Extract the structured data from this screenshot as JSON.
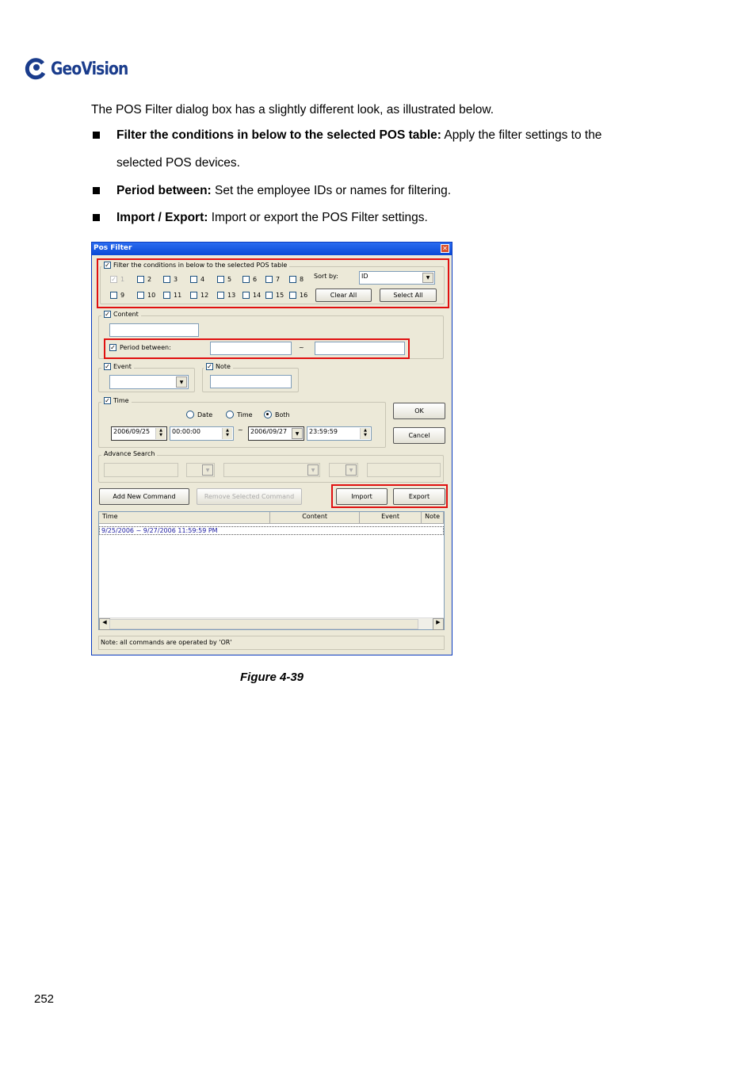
{
  "logo": {
    "text": "GeoVision"
  },
  "intro": "The POS Filter dialog box has a slightly different look, as illustrated below.",
  "bullets": [
    {
      "bold": "Filter the conditions in below to the selected POS table:",
      "text": " Apply the filter settings to the",
      "cont": "selected POS devices."
    },
    {
      "bold": "Period between:",
      "text": " Set the employee IDs or names for filtering."
    },
    {
      "bold": "Import / Export:",
      "text": " Import or export the POS Filter settings."
    }
  ],
  "dialog": {
    "title": "Pos Filter",
    "filter_label": "Filter the conditions in below to the selected POS table",
    "pos_numbers": [
      "1",
      "2",
      "3",
      "4",
      "5",
      "6",
      "7",
      "8",
      "9",
      "10",
      "11",
      "12",
      "13",
      "14",
      "15",
      "16"
    ],
    "sort_by_label": "Sort by:",
    "sort_by_value": "ID",
    "clear_all": "Clear All",
    "select_all": "Select All",
    "content_label": "Content",
    "period_label": "Period between:",
    "tilde": "~",
    "event_label": "Event",
    "note_label": "Note",
    "time_label": "Time",
    "radio_date": "Date",
    "radio_time": "Time",
    "radio_both": "Both",
    "start_date": "2006/09/25",
    "start_time": "00:00:00",
    "end_date": "2006/09/27",
    "end_time": "23:59:59",
    "ok": "OK",
    "cancel": "Cancel",
    "advance_label": "Advance Search",
    "add_cmd": "Add New Command",
    "remove_cmd": "Remove Selected Command",
    "import": "Import",
    "export": "Export",
    "columns": [
      "Time",
      "Content",
      "Event",
      "Note"
    ],
    "rows": [
      "9/25/2006 ~ 9/27/2006 11:59:59 PM"
    ],
    "status": "Note: all commands are operated by 'OR'"
  },
  "caption": "Figure 4-39",
  "page_number": "252"
}
